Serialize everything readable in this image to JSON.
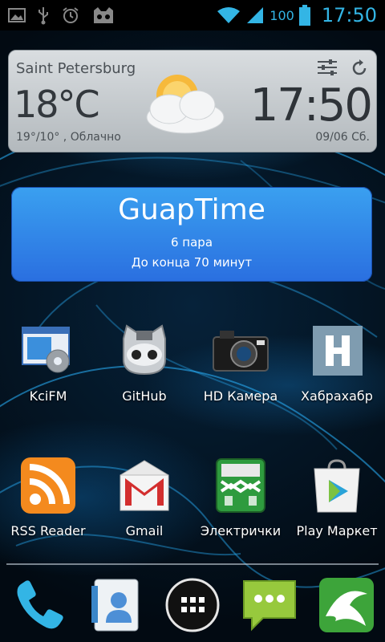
{
  "status_bar": {
    "battery_percent": "100",
    "time": "17:50",
    "icons": [
      "image-icon",
      "usb-icon",
      "alarm-icon",
      "cyanogen-icon",
      "wifi-icon",
      "signal-icon",
      "battery-icon"
    ]
  },
  "weather_widget": {
    "city": "Saint Petersburg",
    "temperature": "18°C",
    "conditions": "19°/10° , Облачно",
    "time": "17:50",
    "date": "09/06 Сб.",
    "icons": [
      "partly-cloudy-icon",
      "settings-sliders-icon",
      "refresh-icon"
    ]
  },
  "guap_widget": {
    "title": "GuapTime",
    "line1": "6 пара",
    "line2": "До конца 70 минут"
  },
  "apps": [
    {
      "label": "KciFM",
      "icon": "kcifm-icon"
    },
    {
      "label": "GitHub",
      "icon": "github-octocat-icon"
    },
    {
      "label": "HD Камера",
      "icon": "camera-icon"
    },
    {
      "label": "Хабрахабр",
      "icon": "habrahabr-icon"
    },
    {
      "label": "RSS Reader",
      "icon": "rss-icon"
    },
    {
      "label": "Gmail",
      "icon": "gmail-icon"
    },
    {
      "label": "Электрички",
      "icon": "train-icon"
    },
    {
      "label": "Play Маркет",
      "icon": "play-store-icon"
    }
  ],
  "dock": [
    "phone-icon",
    "contacts-icon",
    "app-drawer-icon",
    "messaging-icon",
    "dolphin-browser-icon"
  ],
  "colors": {
    "status_accent": "#33b5e5",
    "guap_blue": "#2f84ea",
    "widget_gray": "#c6cbcf"
  }
}
